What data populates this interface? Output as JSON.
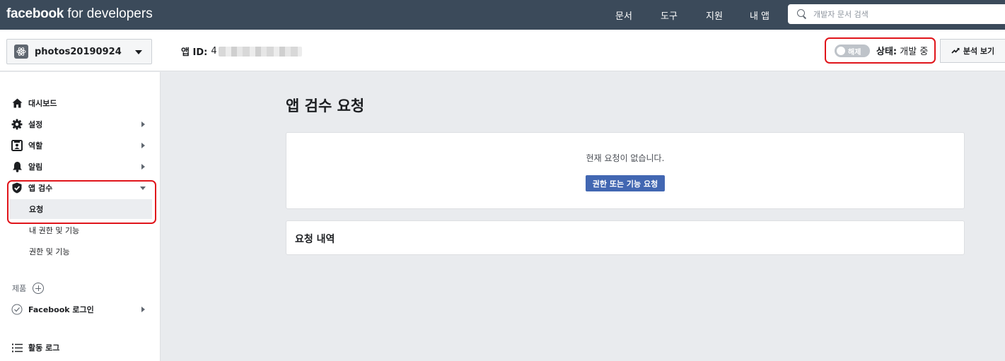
{
  "topnav": {
    "brand_bold": "facebook",
    "brand_rest": " for developers",
    "links": [
      "문서",
      "도구",
      "지원",
      "내 앱"
    ],
    "search_placeholder": "개발자 문서 검색"
  },
  "appbar": {
    "app_name": "photos20190924",
    "app_id_label": "앱 ID:",
    "app_id_visible": "4",
    "toggle_label": "해제",
    "status_label": "상태:",
    "status_value": "개발 중",
    "analytics_label": "분석 보기"
  },
  "sidebar": {
    "dashboard": "대시보드",
    "settings": "설정",
    "roles": "역할",
    "alerts": "알림",
    "app_review": "앱 검수",
    "review_sub": [
      "요청",
      "내 권한 및 기능",
      "권한 및 기능"
    ],
    "products_label": "제품",
    "facebook_login": "Facebook 로그인",
    "activity_log": "활동 로그"
  },
  "main": {
    "title": "앱 검수 요청",
    "empty_message": "현재 요청이 없습니다.",
    "request_button": "권한 또는 기능 요청",
    "history_header": "요청 내역"
  },
  "colors": {
    "topnav_bg": "#3b4a5a",
    "primary_button": "#4267b2",
    "highlight_red": "#e0151b"
  }
}
